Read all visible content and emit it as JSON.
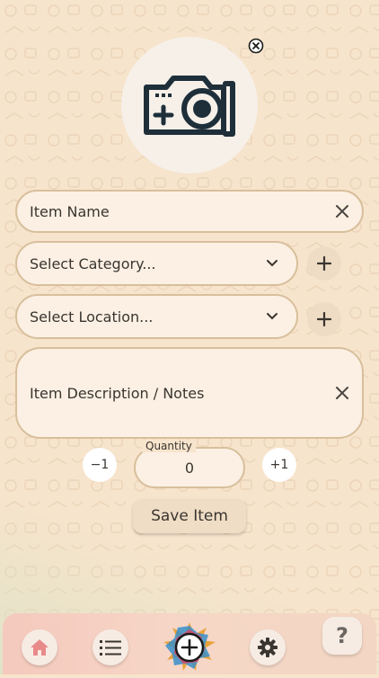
{
  "form": {
    "item_name": {
      "placeholder": "Item Name"
    },
    "category": {
      "selected": "Select Category..."
    },
    "location": {
      "selected": "Select Location..."
    },
    "description": {
      "placeholder": "Item Description / Notes"
    },
    "quantity": {
      "label": "Quantity",
      "value": "0",
      "decrement_label": "−1",
      "increment_label": "+1"
    },
    "save_label": "Save Item"
  },
  "photo": {
    "icon": "camera-add-icon"
  },
  "bottom_nav": {
    "items": [
      {
        "icon": "home-icon",
        "active": true
      },
      {
        "icon": "list-icon"
      },
      {
        "icon": "add-icon"
      },
      {
        "icon": "gear-icon"
      },
      {
        "icon": "help-icon",
        "label": "?"
      }
    ]
  },
  "colors": {
    "background": "#f7e4cc",
    "field_fill": "#fbf0e3",
    "field_border": "#d8bf9c",
    "home_accent": "#e98a8a",
    "bottom_bar": "#f5c9bd"
  }
}
